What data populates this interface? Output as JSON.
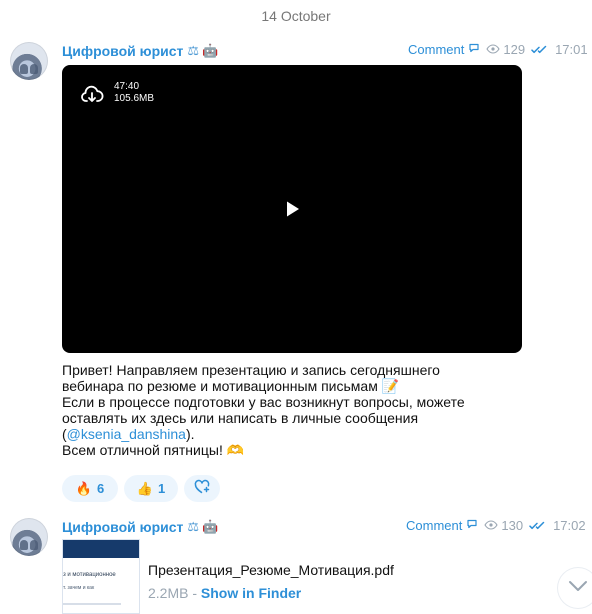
{
  "date": {
    "label": "14 October"
  },
  "messages": [
    {
      "sender": "Цифровой юрист",
      "meta": {
        "comment_label": "Comment",
        "views": "129",
        "time": "17:01"
      },
      "video": {
        "duration": "47:40",
        "size": "105.6MB"
      },
      "text": {
        "line1": "Привет! Направляем презентацию и запись сегодняшнего",
        "line2_prefix": "вебинара по резюме и мотивационным письмам ",
        "line2_emoji": "📝",
        "line3": "Если в процессе подготовки у вас возникнут вопросы, можете",
        "line4": "оставлять их здесь или написать в личные сообщения",
        "line5_open": "(",
        "line5_mention": "@ksenia_danshina",
        "line5_close": ").",
        "line6_prefix": "Всем отличной пятницы! ",
        "line6_emoji": "🫶"
      },
      "reactions": [
        {
          "emoji": "🔥",
          "count": "6"
        },
        {
          "emoji": "👍",
          "count": "1"
        }
      ]
    },
    {
      "sender": "Цифровой юрист",
      "meta": {
        "comment_label": "Comment",
        "views": "130",
        "time": "17:02"
      },
      "document": {
        "thumbnail_line1": "з и мотивационное",
        "thumbnail_line2": "т. зачем и как",
        "name": "Презентация_Резюме_Мотивация.pdf",
        "size": "2.2MB",
        "separator": " - ",
        "action_label": "Show in Finder"
      }
    }
  ]
}
